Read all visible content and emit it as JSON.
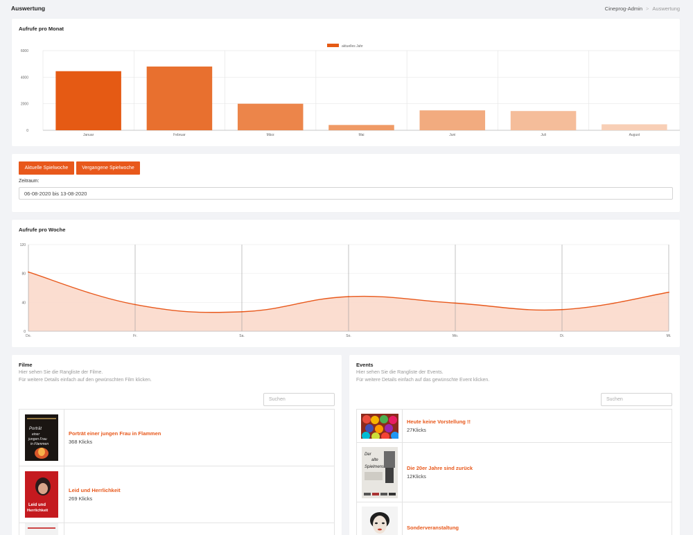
{
  "header": {
    "title": "Auswertung",
    "breadcrumb_root": "Cineprog-Admin",
    "breadcrumb_sep": ">",
    "breadcrumb_current": "Auswertung"
  },
  "monthly": {
    "title": "Aufrufe pro Monat"
  },
  "week_controls": {
    "current_week_label": "Aktuelle Spielwoche",
    "past_week_label": "Vergangene Spielwoche",
    "range_label": "Zeitraum:",
    "range_value": "06-08-2020 bis 13-08-2020"
  },
  "weekly": {
    "title": "Aufrufe pro Woche"
  },
  "films": {
    "title": "Filme",
    "desc_line1": "Hier sehen Sie die Rangliste der Filme.",
    "desc_line2": "Für weitere Details einfach auf den gewünschten Film klicken.",
    "search_placeholder": "Suchen",
    "items": [
      {
        "title": "Porträt einer jungen Frau in Flammen",
        "clicks": "368 Klicks"
      },
      {
        "title": "Leid und Herrlichkeit",
        "clicks": "269 Klicks"
      }
    ]
  },
  "events": {
    "title": "Events",
    "desc_line1": "Hier sehen Sie die Rangliste der Events.",
    "desc_line2": "Für weitere Details einfach auf das gewünschte Event klicken.",
    "search_placeholder": "Suchen",
    "items": [
      {
        "title": "Heute keine Vorstellung !!",
        "clicks": "27Klicks"
      },
      {
        "title": "Die 20er Jahre sind zurück",
        "clicks": "12Klicks"
      },
      {
        "title": "Sonderveranstaltung",
        "clicks": ""
      }
    ]
  },
  "colors": {
    "accent": "#e8581b",
    "area_fill": "#fbd9cb"
  },
  "chart_data": [
    {
      "type": "bar",
      "title": "Aufrufe pro Monat",
      "legend": [
        "aktuelles Jahr"
      ],
      "legend_position": "top",
      "categories": [
        "Januar",
        "Februar",
        "März",
        "Mai",
        "Juni",
        "Juli",
        "August"
      ],
      "series": [
        {
          "name": "aktuelles Jahr",
          "values": [
            4450,
            4800,
            2000,
            400,
            1500,
            1450,
            450
          ]
        }
      ],
      "colors": [
        "#e55a14",
        "#e8702f",
        "#ec854a",
        "#ef9a66",
        "#f2ab7f",
        "#f5bd9a",
        "#f8cfb6"
      ],
      "yticks": [
        "0",
        "2000",
        "4000",
        "6000"
      ],
      "ylim": [
        0,
        6000
      ],
      "grid": true
    },
    {
      "type": "area",
      "title": "Aufrufe pro Woche",
      "categories": [
        "Do.",
        "Fr.",
        "Sa.",
        "So.",
        "Mo.",
        "Di.",
        "Mi."
      ],
      "values": [
        82,
        37,
        27,
        48,
        39,
        30,
        54
      ],
      "yticks": [
        "0",
        "40",
        "80",
        "120"
      ],
      "ylim": [
        0,
        120
      ],
      "grid": true
    }
  ]
}
